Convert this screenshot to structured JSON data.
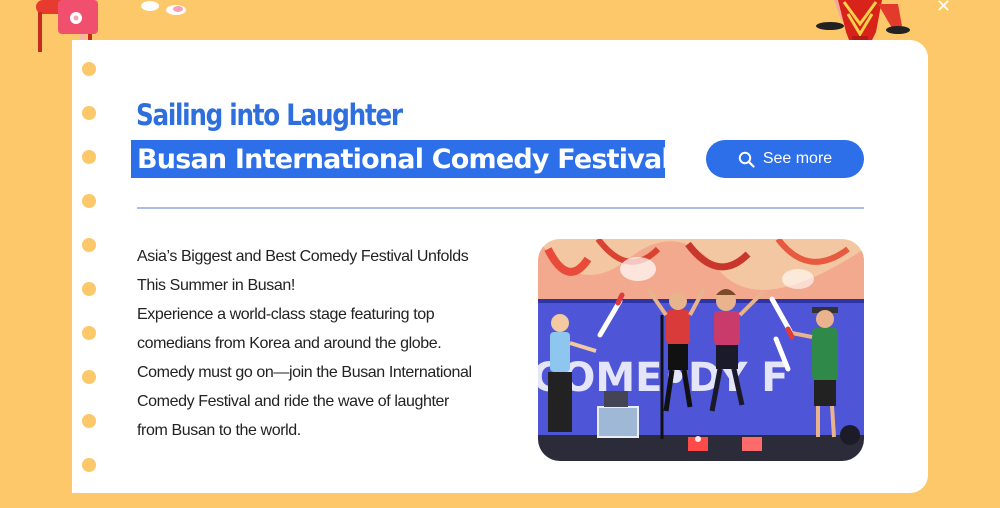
{
  "header": {
    "subtitle": "Sailing into Laughter",
    "title": "Busan International Comedy Festival"
  },
  "actions": {
    "see_more_label": "See more",
    "see_more_icon": "search-icon"
  },
  "description": {
    "lines": [
      "Asia’s Biggest and Best Comedy Festival Unfolds",
      "This Summer in Busan!",
      "Experience a world-class stage featuring top",
      "comedians from Korea and around the globe.",
      "Comedy must go on—join the Busan International",
      "Comedy Festival and ride the wave of laughter",
      "from Busan to the world."
    ]
  },
  "photo": {
    "stage_sign_text": "COME•DY F"
  },
  "colors": {
    "background": "#fdc86a",
    "accent_blue": "#2c6fe8",
    "subtitle_blue": "#2f6fdd",
    "divider": "#a7bfe9"
  }
}
